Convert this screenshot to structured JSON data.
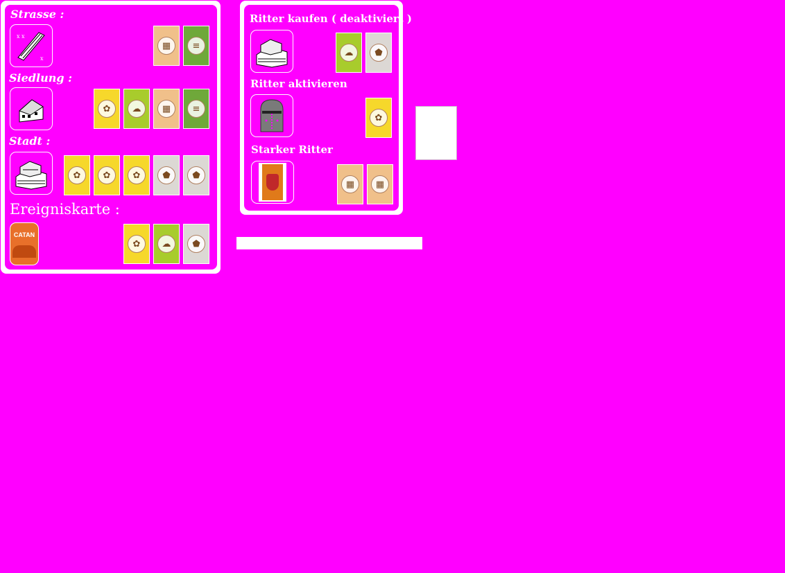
{
  "build_panel": {
    "road_label": "Strasse :",
    "settlement_label": "Siedlung :",
    "city_label": "Stadt :",
    "event_card_label": "Ereigniskarte :",
    "event_card_box_text": "CATAN"
  },
  "knight_panel": {
    "buy_label": "Ritter kaufen ( deaktiviert )",
    "activate_label": "Ritter aktivieren",
    "strong_label": "Starker Ritter"
  },
  "resource_icons": {
    "wheat": "wheat-icon",
    "sheep": "sheep-icon",
    "brick": "brick-icon",
    "wood": "wood-icon",
    "ore": "ore-icon"
  },
  "colors": {
    "background": "#ff00ff",
    "panel_border": "#ffffff",
    "text": "#ffffff"
  }
}
